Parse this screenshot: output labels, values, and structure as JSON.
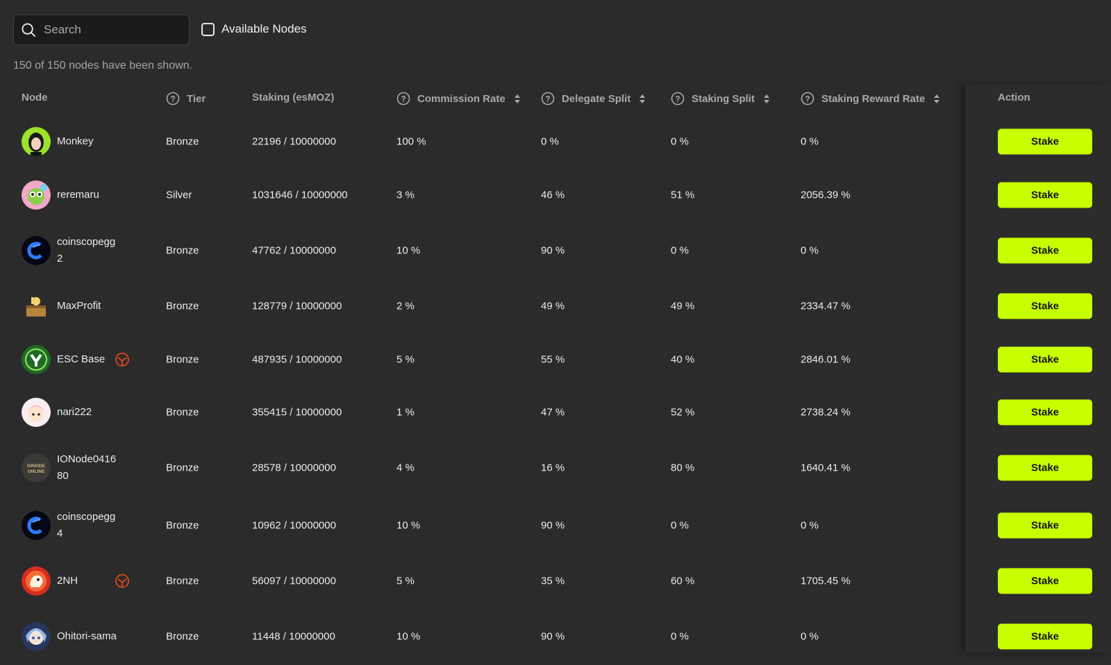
{
  "search": {
    "placeholder": "Search",
    "value": ""
  },
  "filter": {
    "label": "Available Nodes",
    "checked": false
  },
  "summary": "150 of 150 nodes have been shown.",
  "columns": {
    "node": "Node",
    "tier": "Tier",
    "staking": "Staking (esMOZ)",
    "commission": "Commission Rate",
    "delegate": "Delegate Split",
    "staking_split": "Staking Split",
    "reward": "Staking Reward Rate",
    "action": "Action"
  },
  "action_label": "Stake",
  "accent_color": "#c8ff00",
  "badge_color": "#e0461e",
  "rows": [
    {
      "name": "Monkey",
      "tier": "Bronze",
      "staking": "22196 / 10000000",
      "commission": "100 %",
      "delegate": "0 %",
      "staking_split": "0 %",
      "reward": "0 %",
      "avatar": "monkey-avatar",
      "badge": false
    },
    {
      "name": "reremaru",
      "tier": "Silver",
      "staking": "1031646 / 10000000",
      "commission": "3 %",
      "delegate": "46 %",
      "staking_split": "51 %",
      "reward": "2056.39 %",
      "avatar": "reremaru-avatar",
      "badge": false
    },
    {
      "name": "coinscopegg2",
      "tier": "Bronze",
      "staking": "47762 / 10000000",
      "commission": "10 %",
      "delegate": "90 %",
      "staking_split": "0 %",
      "reward": "0 %",
      "avatar": "coinscope-avatar",
      "badge": false
    },
    {
      "name": "MaxProfit",
      "tier": "Bronze",
      "staking": "128779 / 10000000",
      "commission": "2 %",
      "delegate": "49 %",
      "staking_split": "49 %",
      "reward": "2334.47 %",
      "avatar": "maxprofit-avatar",
      "badge": false
    },
    {
      "name": "ESC Base",
      "tier": "Bronze",
      "staking": "487935 / 10000000",
      "commission": "5 %",
      "delegate": "55 %",
      "staking_split": "40 %",
      "reward": "2846.01 %",
      "avatar": "escbase-avatar",
      "badge": true
    },
    {
      "name": "nari222",
      "tier": "Bronze",
      "staking": "355415 / 10000000",
      "commission": "1 %",
      "delegate": "47 %",
      "staking_split": "52 %",
      "reward": "2738.24 %",
      "avatar": "nari-avatar",
      "badge": false
    },
    {
      "name": "IONode041680",
      "tier": "Bronze",
      "staking": "28578 / 10000000",
      "commission": "4 %",
      "delegate": "16 %",
      "staking_split": "80 %",
      "reward": "1640.41 %",
      "avatar": "ionode-avatar",
      "badge": false,
      "avatar_text": "IONODE ONLINE"
    },
    {
      "name": "coinscopegg4",
      "tier": "Bronze",
      "staking": "10962 / 10000000",
      "commission": "10 %",
      "delegate": "90 %",
      "staking_split": "0 %",
      "reward": "0 %",
      "avatar": "coinscope-avatar",
      "badge": false
    },
    {
      "name": "2NH",
      "tier": "Bronze",
      "staking": "56097 / 10000000",
      "commission": "5 %",
      "delegate": "35 %",
      "staking_split": "60 %",
      "reward": "1705.45 %",
      "avatar": "2nh-avatar",
      "badge": true
    },
    {
      "name": "Ohitori-sama",
      "tier": "Bronze",
      "staking": "11448 / 10000000",
      "commission": "10 %",
      "delegate": "90 %",
      "staking_split": "0 %",
      "reward": "0 %",
      "avatar": "ohitori-avatar",
      "badge": false
    }
  ]
}
